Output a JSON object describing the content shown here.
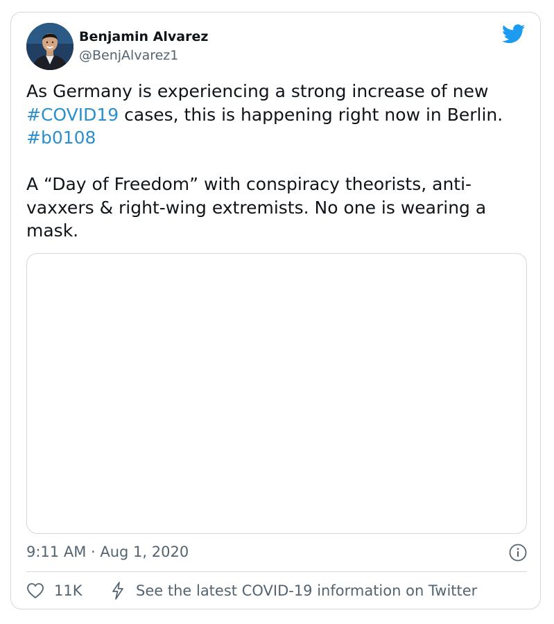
{
  "tweet": {
    "author": {
      "name": "Benjamin Alvarez",
      "handle": "@BenjAlvarez1"
    },
    "text": {
      "p1": {
        "pre": "As Germany is experiencing a strong increase of new ",
        "hashtag1": "#COVID19",
        "mid": " cases, this is happening right now in Berlin. ",
        "hashtag2": "#b0108"
      },
      "p2": "A “Day of Freedom” with conspiracy theorists, anti-vaxxers & right-wing extremists. No one is wearing a mask."
    },
    "timestamp": "9:11 AM · Aug 1, 2020",
    "likes": "11K",
    "covid_info_link": "See the latest COVID-19 information on Twitter"
  },
  "icons": {
    "brand": "twitter-bird-icon",
    "info": "info-icon",
    "like": "heart-icon",
    "covid": "lightning-bolt-icon"
  },
  "colors": {
    "accent": "#1d9bf0",
    "text": "#0f1419",
    "muted": "#536471",
    "border": "#cfd9de"
  }
}
